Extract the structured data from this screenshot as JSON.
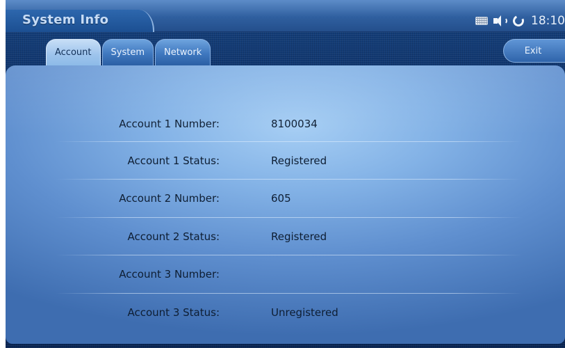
{
  "header": {
    "title": "System Info",
    "clock": "18:10"
  },
  "tabs": [
    {
      "label": "Account",
      "active": true
    },
    {
      "label": "System",
      "active": false
    },
    {
      "label": "Network",
      "active": false
    }
  ],
  "exit_label": "Exit",
  "info_rows": [
    {
      "label": "Account 1 Number:",
      "value": "8100034"
    },
    {
      "label": "Account 1 Status:",
      "value": "Registered"
    },
    {
      "label": "Account 2 Number:",
      "value": "605"
    },
    {
      "label": "Account 2 Status:",
      "value": "Registered"
    },
    {
      "label": "Account 3 Number:",
      "value": ""
    },
    {
      "label": "Account 3 Status:",
      "value": "Unregistered"
    }
  ],
  "status_icons": [
    "keyboard-icon",
    "volume-icon",
    "sync-icon"
  ],
  "colors": {
    "accent": "#2f64aa",
    "panel": "#83b2e6",
    "text": "#0e1e33"
  }
}
